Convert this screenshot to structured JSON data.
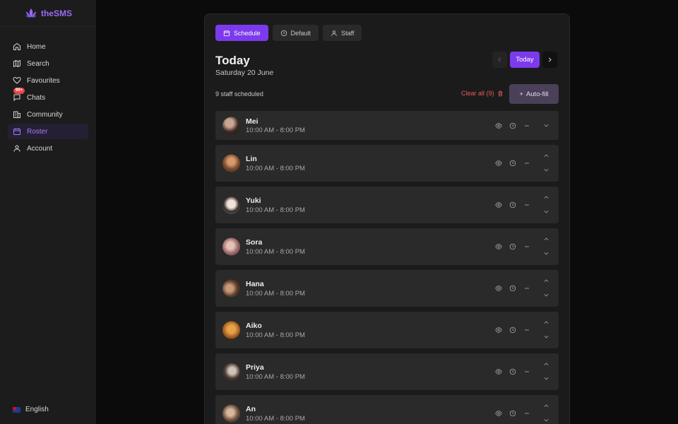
{
  "app": {
    "name": "theSMS"
  },
  "sidebar": {
    "items": [
      {
        "label": "Home",
        "icon": "home-icon"
      },
      {
        "label": "Search",
        "icon": "map-icon"
      },
      {
        "label": "Favourites",
        "icon": "heart-icon"
      },
      {
        "label": "Chats",
        "icon": "chat-icon",
        "badge": "99+"
      },
      {
        "label": "Community",
        "icon": "building-icon"
      },
      {
        "label": "Roster",
        "icon": "calendar-icon",
        "active": true
      },
      {
        "label": "Account",
        "icon": "user-icon"
      }
    ],
    "language": "English"
  },
  "tabs": [
    {
      "label": "Schedule",
      "icon": "calendar-icon",
      "active": true
    },
    {
      "label": "Default",
      "icon": "clock-icon"
    },
    {
      "label": "Staff",
      "icon": "user-icon"
    }
  ],
  "header": {
    "title": "Today",
    "subtitle": "Saturday 20 June",
    "today_button": "Today"
  },
  "summary": {
    "count_text": "9 staff scheduled",
    "clear_text": "Clear all (9)",
    "autofill_text": "Auto-fill"
  },
  "staff": [
    {
      "name": "Mei",
      "time": "10:00 AM - 8:00 PM"
    },
    {
      "name": "Lin",
      "time": "10:00 AM - 8:00 PM"
    },
    {
      "name": "Yuki",
      "time": "10:00 AM - 8:00 PM"
    },
    {
      "name": "Sora",
      "time": "10:00 AM - 8:00 PM"
    },
    {
      "name": "Hana",
      "time": "10:00 AM - 8:00 PM"
    },
    {
      "name": "Aiko",
      "time": "10:00 AM - 8:00 PM"
    },
    {
      "name": "Priya",
      "time": "10:00 AM - 8:00 PM"
    },
    {
      "name": "An",
      "time": "10:00 AM - 8:00 PM"
    }
  ],
  "colors": {
    "accent": "#7c3aed",
    "danger": "#f05a5a"
  }
}
